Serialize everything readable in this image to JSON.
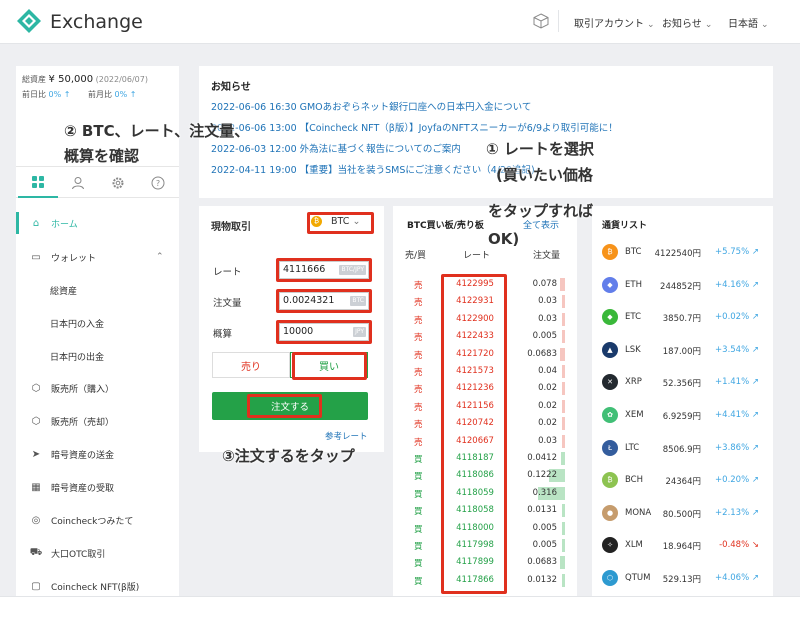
{
  "header": {
    "brand": "Exchange",
    "nav": [
      "取引アカウント",
      "お知らせ",
      "日本語"
    ],
    "chevron": "⌵"
  },
  "sidebar": {
    "assets": {
      "total_label": "総資産",
      "total_value": "¥ 50,000",
      "total_date": "(2022/06/07)",
      "day_label": "前日比",
      "day_value": "0% ↑",
      "month_label": "前月比",
      "month_value": "0% ↑"
    },
    "tab_icons": [
      "grid-icon",
      "user-icon",
      "gear-icon",
      "help-icon"
    ],
    "menu": [
      {
        "label": "ホーム",
        "icon": "home-icon"
      },
      {
        "label": "ウォレット",
        "icon": "wallet-icon"
      },
      {
        "label": "総資産",
        "sub": true
      },
      {
        "label": "日本円の入金",
        "sub": true
      },
      {
        "label": "日本円の出金",
        "sub": true
      },
      {
        "label": "販売所（購入）",
        "icon": "box-icon"
      },
      {
        "label": "販売所（売却）",
        "icon": "box-icon"
      },
      {
        "label": "暗号資産の送金",
        "icon": "send-icon"
      },
      {
        "label": "暗号資産の受取",
        "icon": "qr-icon"
      },
      {
        "label": "Coincheckつみたて",
        "icon": "coin-icon"
      },
      {
        "label": "大口OTC取引",
        "icon": "truck-icon"
      },
      {
        "label": "Coincheck NFT(β版)",
        "icon": "nft-icon"
      }
    ]
  },
  "news": {
    "title": "お知らせ",
    "items": [
      "2022-06-06 16:30 GMOあおぞらネット銀行口座への日本円入金について",
      "2022-06-06 13:00 【Coincheck NFT（β版）】JoyfaのNFTスニーカーが6/9より取引可能に！",
      "2022-06-03 12:00 外為法に基づく報告についてのご案内",
      "2022-04-11 19:00 【重要】当社を装うSMSにご注意ください（4/20追記)"
    ]
  },
  "order": {
    "title": "現物取引",
    "coin": "BTC",
    "rate_label": "レート",
    "rate_value": "4111666",
    "rate_unit": "BTC/JPY",
    "amount_label": "注文量",
    "amount_value": "0.0024321",
    "amount_unit": "BTC",
    "estimate_label": "概算",
    "estimate_value": "10000",
    "estimate_unit": "JPY",
    "sell_label": "売り",
    "buy_label": "買い",
    "submit_label": "注文する",
    "ref_rate": "参考レート"
  },
  "book": {
    "title": "BTC買い板/売り板",
    "show_all": "全て表示",
    "headers": [
      "売/買",
      "レート",
      "注文量"
    ],
    "rows": [
      {
        "side": "売",
        "type": "sell",
        "rate": "4122995",
        "amount": "0.078",
        "depth": 0.1
      },
      {
        "side": "売",
        "type": "sell",
        "rate": "4122931",
        "amount": "0.03",
        "depth": 0.05
      },
      {
        "side": "売",
        "type": "sell",
        "rate": "4122900",
        "amount": "0.03",
        "depth": 0.05
      },
      {
        "side": "売",
        "type": "sell",
        "rate": "4122433",
        "amount": "0.005",
        "depth": 0.02
      },
      {
        "side": "売",
        "type": "sell",
        "rate": "4121720",
        "amount": "0.0683",
        "depth": 0.1
      },
      {
        "side": "売",
        "type": "sell",
        "rate": "4121573",
        "amount": "0.04",
        "depth": 0.06
      },
      {
        "side": "売",
        "type": "sell",
        "rate": "4121236",
        "amount": "0.02",
        "depth": 0.04
      },
      {
        "side": "売",
        "type": "sell",
        "rate": "4121156",
        "amount": "0.02",
        "depth": 0.04
      },
      {
        "side": "売",
        "type": "sell",
        "rate": "4120742",
        "amount": "0.02",
        "depth": 0.04
      },
      {
        "side": "売",
        "type": "sell",
        "rate": "4120667",
        "amount": "0.03",
        "depth": 0.05
      },
      {
        "side": "買",
        "type": "buy",
        "rate": "4118187",
        "amount": "0.0412",
        "depth": 0.08
      },
      {
        "side": "買",
        "type": "buy",
        "rate": "4118086",
        "amount": "0.1222",
        "depth": 0.3
      },
      {
        "side": "買",
        "type": "buy",
        "rate": "4118059",
        "amount": "0.316",
        "depth": 0.5
      },
      {
        "side": "買",
        "type": "buy",
        "rate": "4118058",
        "amount": "0.0131",
        "depth": 0.04
      },
      {
        "side": "買",
        "type": "buy",
        "rate": "4118000",
        "amount": "0.005",
        "depth": 0.02
      },
      {
        "side": "買",
        "type": "buy",
        "rate": "4117998",
        "amount": "0.005",
        "depth": 0.02
      },
      {
        "side": "買",
        "type": "buy",
        "rate": "4117899",
        "amount": "0.0683",
        "depth": 0.1
      },
      {
        "side": "買",
        "type": "buy",
        "rate": "4117866",
        "amount": "0.0132",
        "depth": 0.04
      }
    ]
  },
  "currencies": {
    "title": "通貨リスト",
    "items": [
      {
        "sym": "BTC",
        "price": "4122540円",
        "pct": "+5.75%",
        "dir": "up",
        "color": "#f7931a",
        "glyph": "₿"
      },
      {
        "sym": "ETH",
        "price": "244852円",
        "pct": "+4.16%",
        "dir": "up",
        "color": "#627eea",
        "glyph": "◆"
      },
      {
        "sym": "ETC",
        "price": "3850.7円",
        "pct": "+0.02%",
        "dir": "up",
        "color": "#3ab83a",
        "glyph": "◆"
      },
      {
        "sym": "LSK",
        "price": "187.00円",
        "pct": "+3.54%",
        "dir": "up",
        "color": "#1a3a6b",
        "glyph": "▲"
      },
      {
        "sym": "XRP",
        "price": "52.356円",
        "pct": "+1.41%",
        "dir": "up",
        "color": "#23292f",
        "glyph": "✕"
      },
      {
        "sym": "XEM",
        "price": "6.9259円",
        "pct": "+4.41%",
        "dir": "up",
        "color": "#41bf76",
        "glyph": "✿"
      },
      {
        "sym": "LTC",
        "price": "8506.9円",
        "pct": "+3.86%",
        "dir": "up",
        "color": "#345d9d",
        "glyph": "Ł"
      },
      {
        "sym": "BCH",
        "price": "24364円",
        "pct": "+0.20%",
        "dir": "up",
        "color": "#8dc351",
        "glyph": "₿"
      },
      {
        "sym": "MONA",
        "price": "80.500円",
        "pct": "+2.13%",
        "dir": "up",
        "color": "#c69c6d",
        "glyph": "●"
      },
      {
        "sym": "XLM",
        "price": "18.964円",
        "pct": "-0.48%",
        "dir": "down",
        "color": "#222222",
        "glyph": "✧"
      },
      {
        "sym": "QTUM",
        "price": "529.13円",
        "pct": "+4.06%",
        "dir": "up",
        "color": "#2e9ad0",
        "glyph": "⬡"
      }
    ]
  },
  "annotations": {
    "a1_line1": "②  BTC、レート、注文量、",
    "a1_line2": "概算を確認",
    "a2_line1": "①  レートを選択",
    "a2_line2": "(買いたい価格",
    "a2_line3": "をタップすれば",
    "a2_line4": "OK)",
    "a3": "③注文するをタップ"
  },
  "colors": {
    "accent": "#2db7a4",
    "sell": "#e0301e",
    "buy": "#24a148",
    "link": "#1f73b7"
  }
}
